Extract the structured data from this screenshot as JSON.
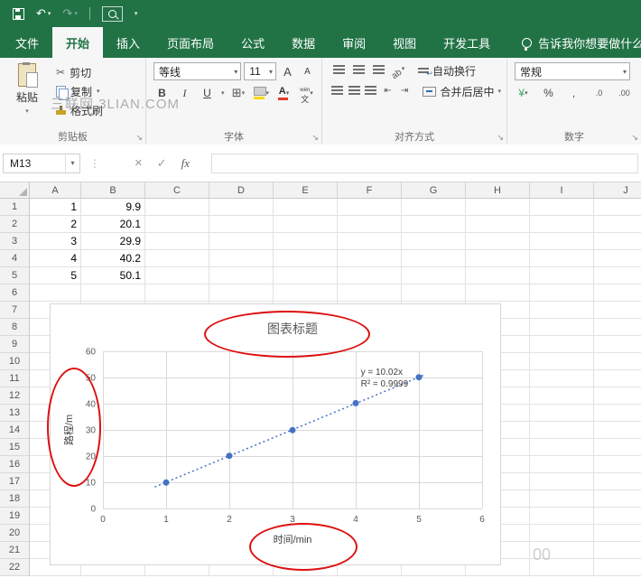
{
  "colors": {
    "accent": "#217346",
    "point_color": "#4472c4",
    "trend_color": "#4472c4",
    "annotation_red": "#dd1010",
    "chart_gridline": "#d9d9d9"
  },
  "ribbon_tabs": {
    "tabs": [
      {
        "id": "file",
        "label": "文件",
        "active": false
      },
      {
        "id": "home",
        "label": "开始",
        "active": true
      },
      {
        "id": "insert",
        "label": "插入",
        "active": false
      },
      {
        "id": "page-layout",
        "label": "页面布局",
        "active": false
      },
      {
        "id": "formulas",
        "label": "公式",
        "active": false
      },
      {
        "id": "data",
        "label": "数据",
        "active": false
      },
      {
        "id": "review",
        "label": "审阅",
        "active": false
      },
      {
        "id": "view",
        "label": "视图",
        "active": false
      },
      {
        "id": "developer",
        "label": "开发工具",
        "active": false
      }
    ],
    "tell_me": "告诉我你想要做什么"
  },
  "ribbon": {
    "clipboard": {
      "label": "剪贴板",
      "paste": "粘贴",
      "cut": "剪切",
      "copy": "复制",
      "format_painter": "格式刷"
    },
    "font": {
      "label": "字体",
      "font_name": "等线",
      "font_size": "11",
      "bold": "B",
      "italic": "I",
      "underline": "U"
    },
    "alignment": {
      "label": "对齐方式",
      "wrap_text": "自动换行",
      "merge_center": "合并后居中"
    },
    "number": {
      "label": "数字",
      "format": "常规",
      "percent": "%",
      "comma": ",",
      "dec_inc": ".0",
      "dec_dec": ".00"
    }
  },
  "formula_bar": {
    "name_box": "M13",
    "fx_label": "fx",
    "formula": ""
  },
  "watermark": {
    "main": "三联网 3LIAN.COM",
    "corner": "00"
  },
  "grid": {
    "columns": [
      "A",
      "B",
      "C",
      "D",
      "E",
      "F",
      "G",
      "H",
      "I",
      "J"
    ],
    "row_count": 22,
    "cells": [
      [
        "1",
        "9.9"
      ],
      [
        "2",
        "20.1"
      ],
      [
        "3",
        "29.9"
      ],
      [
        "4",
        "40.2"
      ],
      [
        "5",
        "50.1"
      ]
    ]
  },
  "chart_data": {
    "type": "scatter",
    "title": "图表标题",
    "xlabel": "时间/min",
    "ylabel": "路程/m",
    "x": [
      1,
      2,
      3,
      4,
      5
    ],
    "y": [
      9.9,
      20.1,
      29.9,
      40.2,
      50.1
    ],
    "xlim": [
      0,
      6
    ],
    "ylim": [
      0,
      60
    ],
    "xticks": [
      0,
      1,
      2,
      3,
      4,
      5,
      6
    ],
    "yticks": [
      0,
      10,
      20,
      30,
      40,
      50,
      60
    ],
    "grid": true,
    "legend": false,
    "trendline": {
      "slope": 10.02,
      "style": "dotted",
      "x_start": 0.82,
      "x_end": 5.08
    },
    "annotation": {
      "lines": [
        "y = 10.02x",
        "R² = 0.9999"
      ],
      "x": 4.08,
      "y": 51
    }
  }
}
